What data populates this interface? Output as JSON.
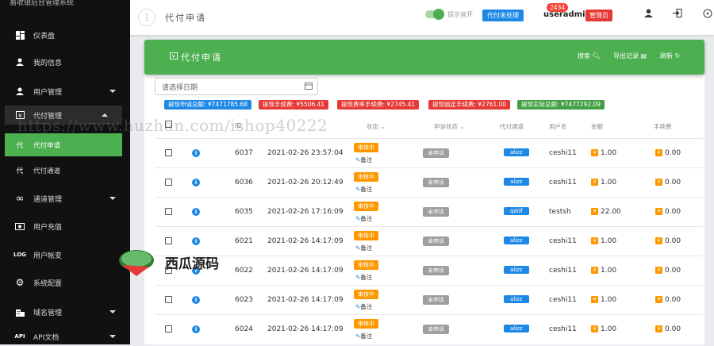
{
  "brand": "易收银后台管理系统",
  "sidebar": {
    "items": [
      {
        "icon": "dashboard-icon",
        "label": "仪表盘"
      },
      {
        "icon": "person-icon",
        "label": "我的信息"
      },
      {
        "icon": "person-icon",
        "label": "用户管理"
      },
      {
        "icon": "payment-icon",
        "label": "代付管理"
      },
      {
        "icon": "",
        "prefix": "代",
        "label": "代付申请"
      },
      {
        "icon": "",
        "prefix": "代",
        "label": "代付通道"
      },
      {
        "icon": "infinity-icon",
        "label": "通道管理"
      },
      {
        "icon": "cash-icon",
        "label": "用户充值"
      },
      {
        "icon": "",
        "prefix": "LOG",
        "label": "用户帐变"
      },
      {
        "icon": "gear-icon",
        "label": "系统配置"
      },
      {
        "icon": "building-icon",
        "label": "域名管理"
      },
      {
        "icon": "",
        "prefix": "API",
        "label": "API文档"
      }
    ]
  },
  "topbar": {
    "menu_icon": "⋮",
    "title": "代付申请",
    "toggle_label": "提示音开",
    "pending_label": "代付未处理",
    "pending_count": "2434",
    "username": "useradmin",
    "role": "管理员"
  },
  "card": {
    "title": "代付申请",
    "search_label": "搜索",
    "export_label": "导出记录",
    "refresh_label": "刷新"
  },
  "date_placeholder": "请选择日期",
  "summary": [
    {
      "text": "提现申请总额: ¥7471785.68",
      "color": "#1e88e5"
    },
    {
      "text": "提现手续费: ¥5506.41",
      "color": "#e53935"
    },
    {
      "text": "提现费率手续费: ¥2745.41",
      "color": "#e53935"
    },
    {
      "text": "提现固定手续费: ¥2761.00",
      "color": "#e53935"
    },
    {
      "text": "提现实际总额: ¥7477292.09",
      "color": "#43a047"
    }
  ],
  "columns": {
    "id": "ID",
    "status": "状态",
    "appeal": "申诉状态",
    "channel": "代付通道",
    "user": "用户名",
    "amount": "金额",
    "fee": "手续费"
  },
  "row_labels": {
    "process": "审核中",
    "note": "备注",
    "appeal": "未申诉"
  },
  "rows": [
    {
      "id": "6037",
      "time": "2021-02-26 23:57:04",
      "channel": "alizz",
      "user": "ceshi11",
      "amount": "1.00",
      "fee": "0.00"
    },
    {
      "id": "6036",
      "time": "2021-02-26 20:12:49",
      "channel": "alizz",
      "user": "ceshi11",
      "amount": "1.00",
      "fee": "0.00"
    },
    {
      "id": "6035",
      "time": "2021-02-26 17:16:09",
      "channel": "qddf",
      "user": "testsh",
      "amount": "22.00",
      "fee": "0.00"
    },
    {
      "id": "6021",
      "time": "2021-02-26 14:17:09",
      "channel": "alizz",
      "user": "ceshi11",
      "amount": "1.00",
      "fee": "0.00"
    },
    {
      "id": "6022",
      "time": "2021-02-26 14:17:09",
      "channel": "alizz",
      "user": "ceshi11",
      "amount": "1.00",
      "fee": "0.00"
    },
    {
      "id": "6023",
      "time": "2021-02-26 14:17:09",
      "channel": "alizz",
      "user": "ceshi11",
      "amount": "1.00",
      "fee": "0.00"
    },
    {
      "id": "6024",
      "time": "2021-02-26 14:17:09",
      "channel": "alizz",
      "user": "ceshi11",
      "amount": "1.00",
      "fee": "0.00"
    }
  ],
  "watermark": "https://www.huzhan.com/ishop40222",
  "logo_text": "西瓜源码"
}
